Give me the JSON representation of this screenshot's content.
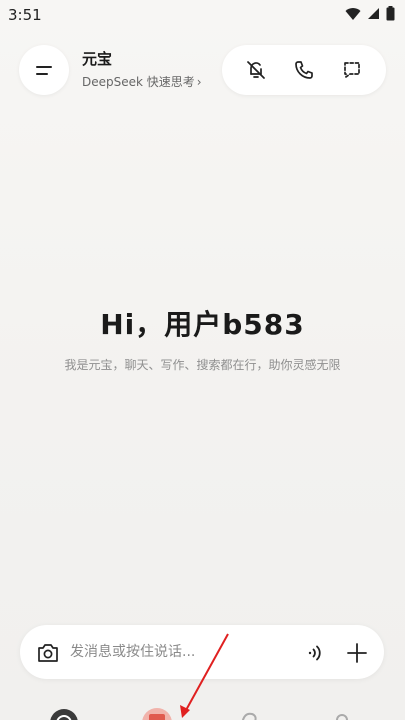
{
  "status_bar": {
    "time": "3:51"
  },
  "header": {
    "title": "元宝",
    "model_label": "DeepSeek 快速思考",
    "model_chevron": "›"
  },
  "header_actions": [
    "mute-icon",
    "phone-icon",
    "chat-bubble-icon"
  ],
  "main": {
    "greeting": "Hi，用户b583",
    "subtitle": "我是元宝，聊天、写作、搜索都在行，助你灵感无限"
  },
  "composer": {
    "placeholder": "发消息或按住说话..."
  },
  "bottom_nav": [
    "chat-nav-icon",
    "app-nav-icon",
    "discover-nav-icon",
    "profile-nav-icon"
  ],
  "colors": {
    "background": "#f5f4f2",
    "accent_red": "#e05a4e",
    "arrow_red": "#e02020"
  }
}
